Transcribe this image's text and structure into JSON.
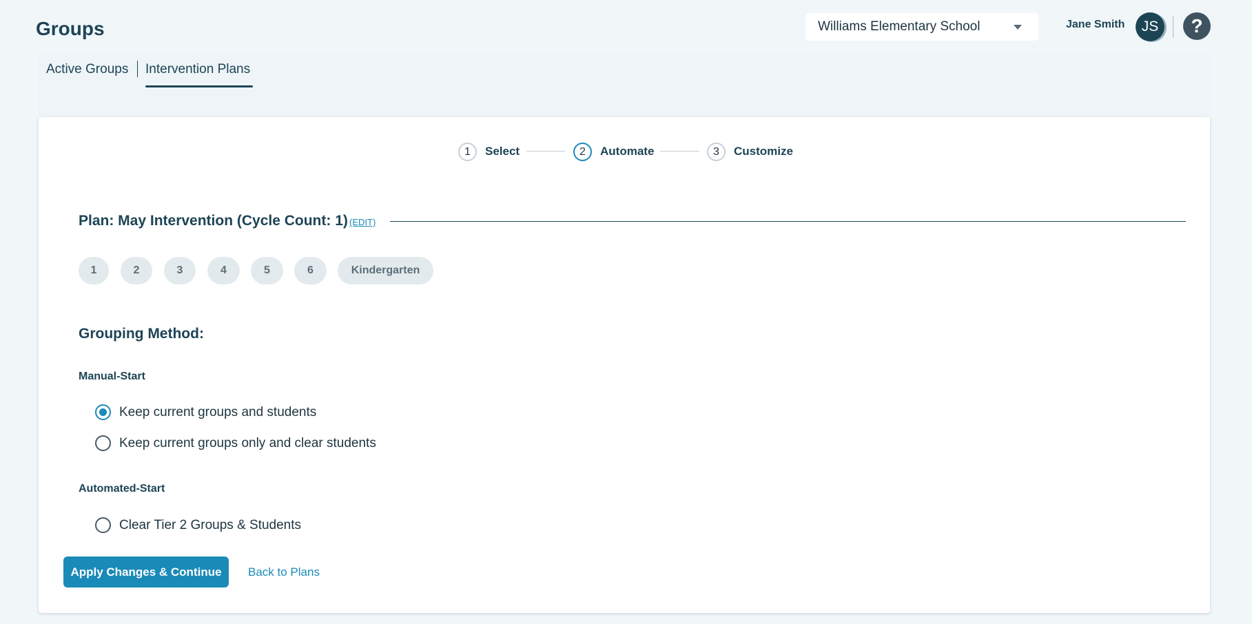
{
  "header": {
    "title": "Groups",
    "school_select": {
      "selected": "Williams Elementary School"
    },
    "user": {
      "name": "Jane Smith",
      "initials": "JS"
    },
    "help_icon": "question-mark-icon"
  },
  "tabs": [
    {
      "label": "Active Groups",
      "active": false
    },
    {
      "label": "Intervention Plans",
      "active": true
    }
  ],
  "stepper": [
    {
      "number": "1",
      "label": "Select",
      "active": false
    },
    {
      "number": "2",
      "label": "Automate",
      "active": true
    },
    {
      "number": "3",
      "label": "Customize",
      "active": false
    }
  ],
  "plan": {
    "title": "Plan: May Intervention (Cycle Count: 1)",
    "edit_label": "(EDIT)"
  },
  "grades": [
    "1",
    "2",
    "3",
    "4",
    "5",
    "6",
    "Kindergarten"
  ],
  "grouping": {
    "title": "Grouping Method:",
    "manual": {
      "title": "Manual-Start",
      "options": [
        {
          "label": "Keep current groups and students",
          "checked": true
        },
        {
          "label": "Keep current groups only and clear students",
          "checked": false
        }
      ]
    },
    "automated": {
      "title": "Automated-Start",
      "options": [
        {
          "label": "Clear Tier 2 Groups & Students",
          "checked": false
        }
      ]
    }
  },
  "actions": {
    "apply_label": "Apply Changes & Continue",
    "back_label": "Back to Plans"
  },
  "colors": {
    "primary": "#1a8ab8",
    "text_dark": "#1d4455",
    "background": "#f1f6f9"
  }
}
